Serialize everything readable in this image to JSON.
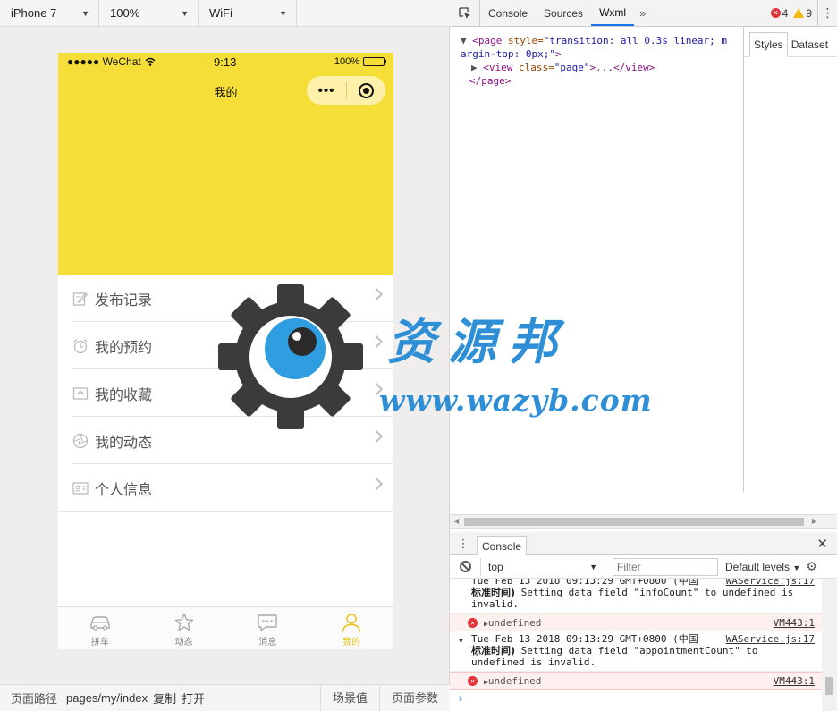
{
  "toolbar": {
    "device": "iPhone 7",
    "zoom": "100%",
    "network": "WiFi"
  },
  "phone": {
    "status": {
      "carrier": "●●●●● WeChat",
      "time": "9:13",
      "battery": "100%"
    },
    "nav_title": "我的",
    "capsule_more": "•••",
    "menu": [
      {
        "label": "发布记录",
        "icon": "edit-note-icon"
      },
      {
        "label": "我的预约",
        "icon": "alarm-clock-icon"
      },
      {
        "label": "我的收藏",
        "icon": "favorites-icon"
      },
      {
        "label": "我的动态",
        "icon": "aperture-icon"
      },
      {
        "label": "个人信息",
        "icon": "id-card-icon"
      }
    ],
    "tabs": [
      {
        "label": "拼车",
        "icon": "car-icon"
      },
      {
        "label": "动态",
        "icon": "star-icon"
      },
      {
        "label": "消息",
        "icon": "chat-icon"
      },
      {
        "label": "我的",
        "icon": "user-icon"
      }
    ],
    "active_tab": 3,
    "accent": "#f5de37",
    "tab_active_color": "#e6c21b"
  },
  "pathbar": {
    "label": "页面路径",
    "path": "pages/my/index",
    "copy": "复制",
    "open": "打开",
    "scene": "场景值",
    "params": "页面参数"
  },
  "devtools": {
    "tabs": [
      "Console",
      "Sources",
      "Wxml"
    ],
    "active_tab": "Wxml",
    "more": "»",
    "errors": "4",
    "warnings": "9",
    "wxml": {
      "line1_tag": "<page",
      "line1_attr": "style=",
      "line1_val": "\"transition: all 0.3s linear; m",
      "line2_val": "argin-top: 0px;\"",
      "line2_end": ">",
      "line3_open": "<view",
      "line3_attr": "class=",
      "line3_val": "\"page\"",
      "line3_rest": ">...</view>",
      "line4": "</page>"
    },
    "styles_tabs": [
      "Styles",
      "Dataset"
    ],
    "console": {
      "tab": "Console",
      "context": "top",
      "filter_placeholder": "Filter",
      "levels": "Default levels",
      "logs": [
        {
          "type": "warn",
          "head": "Tue Feb 13 2018 09:13:29 GMT+0800 (中国",
          "src": "WAService.js:17",
          "bold": "标准时间)",
          "text": " Setting data field \"infoCount\" to undefined is",
          "text2": "invalid."
        },
        {
          "type": "error",
          "text": "undefined",
          "src": "VM443:1"
        },
        {
          "type": "warn",
          "head": "Tue Feb 13 2018 09:13:29 GMT+0800 (中国",
          "src": "WAService.js:17",
          "bold": "标准时间)",
          "text": " Setting data field \"appointmentCount\" to",
          "text2": "undefined is invalid."
        },
        {
          "type": "error",
          "text": "undefined",
          "src": "VM443:1"
        }
      ],
      "prompt": "›"
    }
  },
  "watermark": {
    "title": "资源邦",
    "url": "www.wazyb.com"
  }
}
